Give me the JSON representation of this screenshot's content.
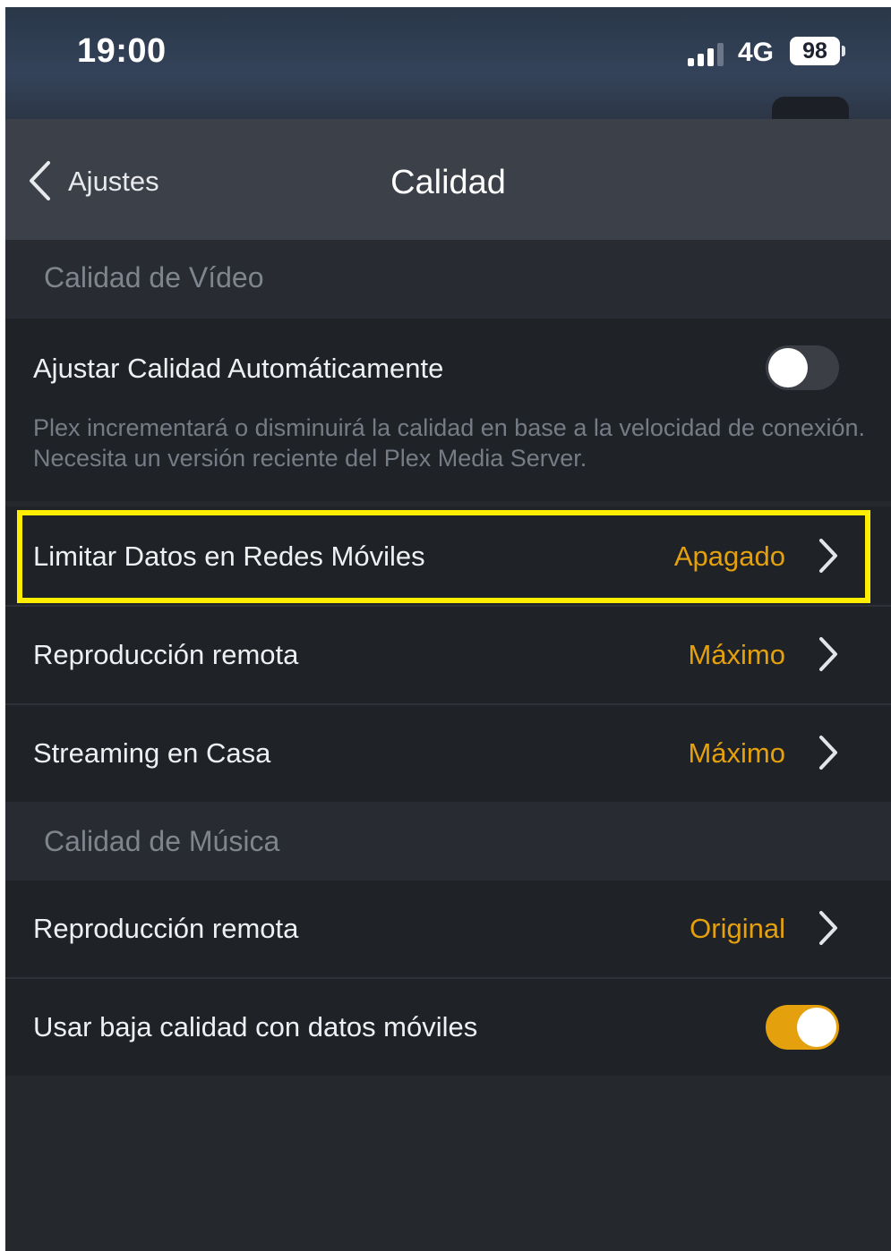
{
  "status_bar": {
    "time": "19:00",
    "network": "4G",
    "battery": "98"
  },
  "nav": {
    "back_label": "Ajustes",
    "title": "Calidad"
  },
  "video_section": {
    "header": "Calidad de Vídeo",
    "auto_quality": {
      "label": "Ajustar Calidad Automáticamente",
      "enabled": false,
      "description": "Plex incrementará o disminuirá la calidad en base a la velocidad de conexión. Necesita un versión reciente del Plex Media Server."
    },
    "rows": [
      {
        "label": "Limitar Datos en Redes Móviles",
        "value": "Apagado"
      },
      {
        "label": "Reproducción remota",
        "value": "Máximo"
      },
      {
        "label": "Streaming en Casa",
        "value": "Máximo"
      }
    ]
  },
  "music_section": {
    "header": "Calidad de Música",
    "rows": [
      {
        "label": "Reproducción remota",
        "value": "Original"
      }
    ],
    "low_quality_mobile": {
      "label": "Usar baja calidad con datos móviles",
      "enabled": true
    }
  },
  "colors": {
    "accent": "#e5a00d",
    "highlight_border": "#ffee00",
    "background": "#25282d",
    "row_background": "#1f2227",
    "navbar": "#3c4048"
  },
  "icons": {
    "back": "chevron-left-icon",
    "row_arrow": "chevron-right-icon",
    "signal": "cellular-signal-icon",
    "battery": "battery-icon"
  }
}
